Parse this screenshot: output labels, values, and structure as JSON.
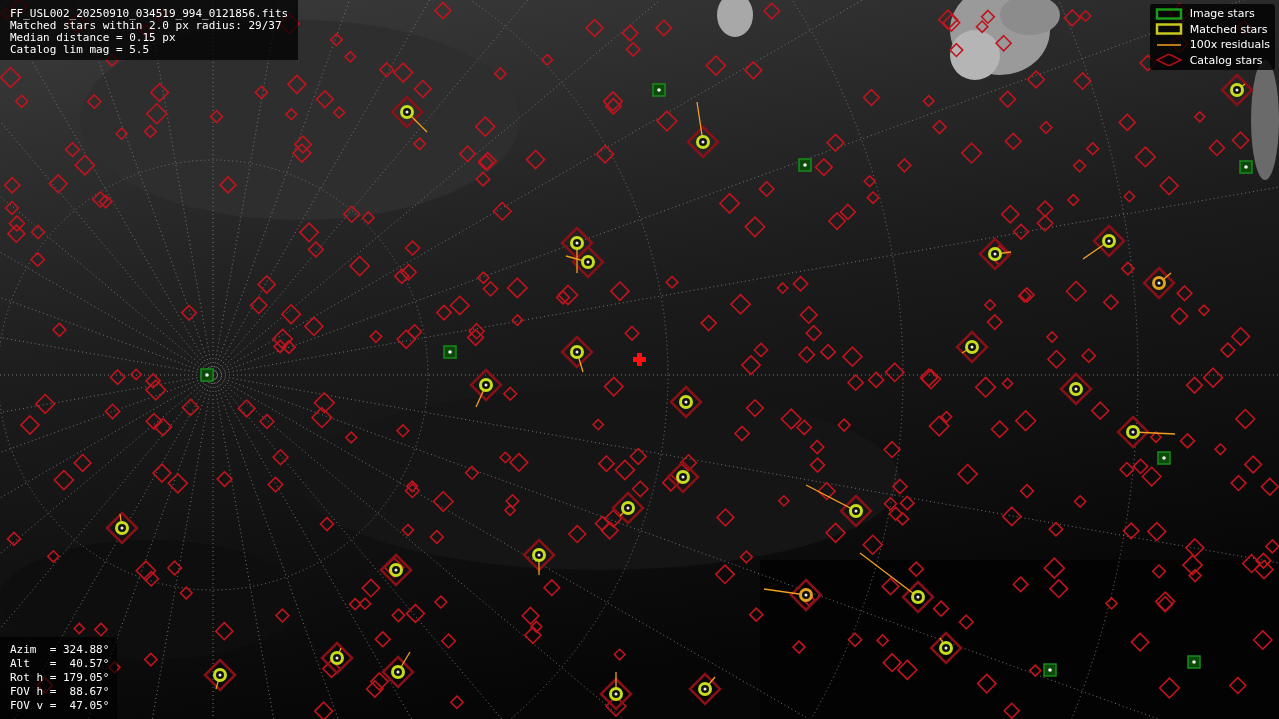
{
  "info": {
    "lines": [
      "FF_USL002_20250910_034519_994_0121856.fits",
      "Matched stars within 2.0 px radius: 29/37",
      "Median distance = 0.15 px",
      "Catalog lim mag = 5.5"
    ]
  },
  "legend": {
    "items": [
      {
        "label": "Image stars"
      },
      {
        "kind": "matched",
        "label": "Matched stars"
      },
      {
        "kind": "residual",
        "label": "100x residuals"
      },
      {
        "kind": "catalog",
        "label": "Catalog stars"
      }
    ]
  },
  "pointing": {
    "lines": [
      "Azim  = 324.88°",
      "Alt   =  40.57°",
      "Rot h = 179.05°",
      "FOV h =  88.67°",
      "FOV v =  47.05°"
    ]
  }
}
